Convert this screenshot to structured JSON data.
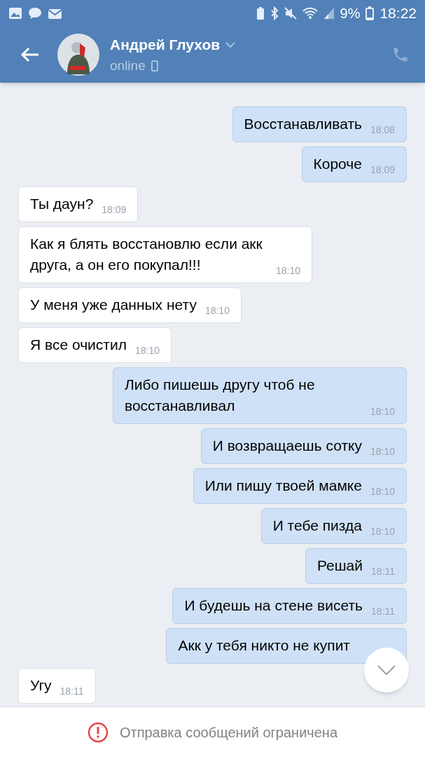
{
  "status_bar": {
    "battery": "9%",
    "time": "18:22"
  },
  "header": {
    "name": "Андрей Глухов",
    "presence": "online"
  },
  "messages": [
    {
      "kind": "outgoing",
      "text": "Восстанавливать",
      "time": "18:08"
    },
    {
      "kind": "outgoing",
      "text": "Короче",
      "time": "18:09"
    },
    {
      "kind": "incoming",
      "text": "Ты даун?",
      "time": "18:09"
    },
    {
      "kind": "incoming",
      "text": "Как я блять восстановлю если акк друга,  а он его покупал!!!",
      "time": "18:10"
    },
    {
      "kind": "incoming",
      "text": "У меня уже данных нету",
      "time": "18:10"
    },
    {
      "kind": "incoming",
      "text": "Я все очистил",
      "time": "18:10"
    },
    {
      "kind": "outgoing",
      "text": "Либо пишешь другу чтоб не восстанавливал",
      "time": "18:10"
    },
    {
      "kind": "outgoing",
      "text": "И возвращаешь сотку",
      "time": "18:10"
    },
    {
      "kind": "outgoing",
      "text": "Или пишу твоей мамке",
      "time": "18:10"
    },
    {
      "kind": "outgoing",
      "text": "И тебе пизда",
      "time": "18:10"
    },
    {
      "kind": "outgoing",
      "text": "Решай",
      "time": "18:11"
    },
    {
      "kind": "outgoing",
      "text": "И будешь на стене висеть",
      "time": "18:11"
    },
    {
      "kind": "outgoing",
      "text": "Акк у тебя никто не купит"
    },
    {
      "kind": "incoming",
      "text": "Угу",
      "time": "18:11"
    }
  ],
  "footer": {
    "notice": "Отправка сообщений ограничена"
  }
}
